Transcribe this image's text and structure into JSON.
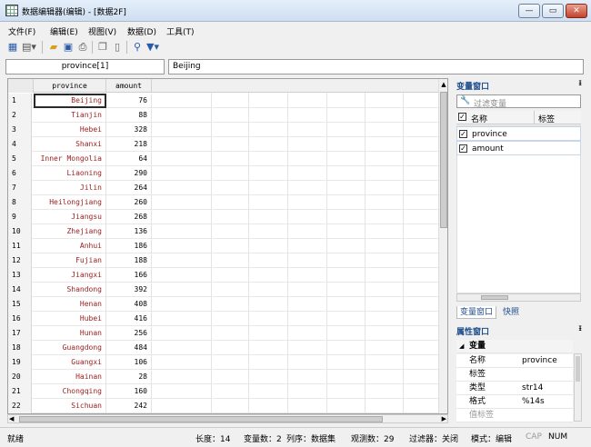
{
  "window": {
    "title": "数据编辑器(编辑) - [数据2F]",
    "min": "—",
    "max": "▭",
    "close": "✕"
  },
  "menu": [
    "文件(F)",
    "编辑(E)",
    "视图(V)",
    "数据(D)",
    "工具(T)"
  ],
  "toolbar": {
    "icons": [
      "grid-icon",
      "table-dropdown-icon",
      "open-folder-icon",
      "save-icon",
      "print-icon",
      "copy-icon",
      "paste-icon",
      "search-icon",
      "filter-icon"
    ]
  },
  "editor": {
    "varname": "province[1]",
    "value": "Beijing"
  },
  "grid": {
    "columns": [
      "province",
      "amount"
    ],
    "rows": [
      {
        "n": "1",
        "province": "Beijing",
        "amount": "76"
      },
      {
        "n": "2",
        "province": "Tianjin",
        "amount": "88"
      },
      {
        "n": "3",
        "province": "Hebei",
        "amount": "328"
      },
      {
        "n": "4",
        "province": "Shanxi",
        "amount": "218"
      },
      {
        "n": "5",
        "province": "Inner Mongolia",
        "amount": "64"
      },
      {
        "n": "6",
        "province": "Liaoning",
        "amount": "290"
      },
      {
        "n": "7",
        "province": "Jilin",
        "amount": "264"
      },
      {
        "n": "8",
        "province": "Heilongjiang",
        "amount": "260"
      },
      {
        "n": "9",
        "province": "Jiangsu",
        "amount": "268"
      },
      {
        "n": "10",
        "province": "Zhejiang",
        "amount": "136"
      },
      {
        "n": "11",
        "province": "Anhui",
        "amount": "186"
      },
      {
        "n": "12",
        "province": "Fujian",
        "amount": "188"
      },
      {
        "n": "13",
        "province": "Jiangxi",
        "amount": "166"
      },
      {
        "n": "14",
        "province": "Shandong",
        "amount": "392"
      },
      {
        "n": "15",
        "province": "Henan",
        "amount": "408"
      },
      {
        "n": "16",
        "province": "Hubei",
        "amount": "416"
      },
      {
        "n": "17",
        "province": "Hunan",
        "amount": "256"
      },
      {
        "n": "18",
        "province": "Guangdong",
        "amount": "484"
      },
      {
        "n": "19",
        "province": "Guangxi",
        "amount": "106"
      },
      {
        "n": "20",
        "province": "Hainan",
        "amount": "28"
      },
      {
        "n": "21",
        "province": "Chongqing",
        "amount": "160"
      },
      {
        "n": "22",
        "province": "Sichuan",
        "amount": "242"
      }
    ]
  },
  "var_panel": {
    "title": "变量窗口",
    "pin": "ᵻ",
    "filter_placeholder": "过滤变量",
    "col_name": "名称",
    "col_label": "标签",
    "vars": [
      "province",
      "amount"
    ]
  },
  "tabs": [
    "变量窗口",
    "快照"
  ],
  "prop_panel": {
    "title": "属性窗口",
    "pin": "ᵻ",
    "section": "变量",
    "rows": [
      {
        "k": "名称",
        "v": "province"
      },
      {
        "k": "标签",
        "v": ""
      },
      {
        "k": "类型",
        "v": "str14"
      },
      {
        "k": "格式",
        "v": "%14s"
      },
      {
        "k": "值标签",
        "v": ""
      }
    ]
  },
  "status": {
    "ready": "就绪",
    "length": "长度：14",
    "nvars": "变量数：2",
    "order": "列序：数据集",
    "nobs": "观测数：29",
    "filter": "过滤器：关闭",
    "mode": "模式：编辑",
    "cap": "CAP",
    "num": "NUM"
  }
}
